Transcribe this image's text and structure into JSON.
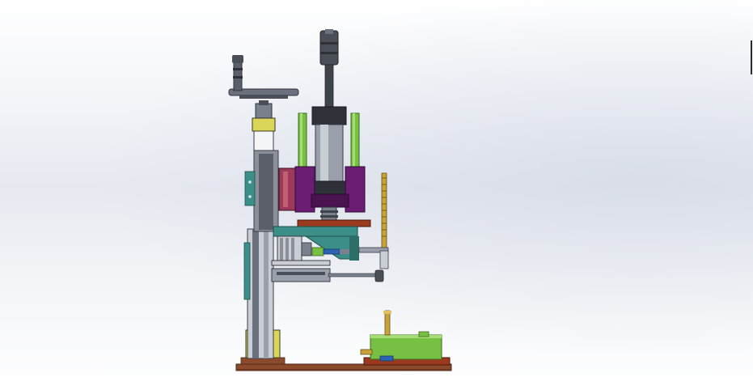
{
  "viewport": {
    "background_top": "#ffffff",
    "background_mid": "#e6e9f0",
    "background_bottom": "#ffffff"
  },
  "model": {
    "colors": {
      "steel_dark": "#4a4e57",
      "steel_mid": "#7a808c",
      "steel_light": "#c9cdd4",
      "green": "#77c043",
      "green_dark": "#4f8a2a",
      "purple": "#6a1d73",
      "purple_dark": "#4b1250",
      "teal": "#3c8f88",
      "teal_dark": "#2e6e69",
      "yellow": "#d9d65a",
      "brown": "#8a4a2b",
      "brown_dark": "#6a3620",
      "brass": "#c8a23a",
      "red_brown": "#9b3a1e",
      "blue": "#2d63b3"
    }
  }
}
